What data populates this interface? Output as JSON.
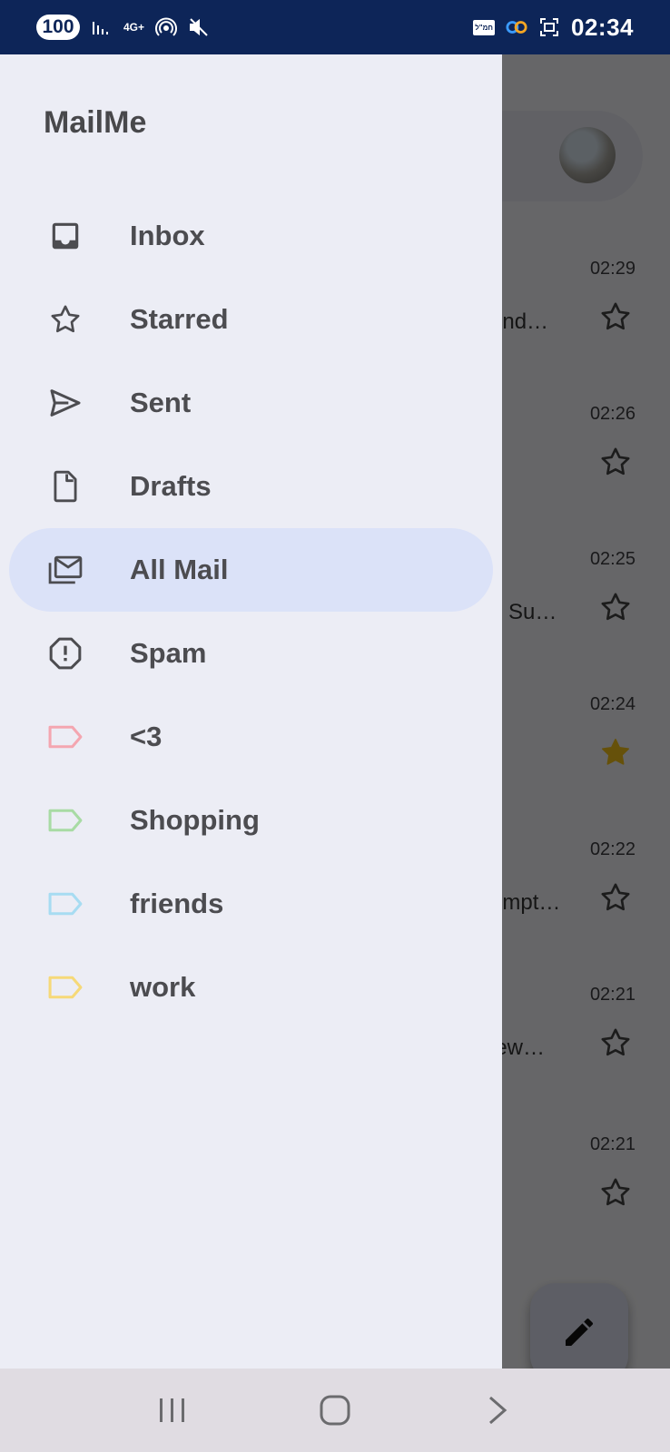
{
  "status_bar": {
    "battery": "100",
    "network": "4G+",
    "carrier_badge": "חמ\"ל",
    "time": "02:34"
  },
  "drawer": {
    "app_title": "MailMe",
    "items": [
      {
        "label": "Inbox",
        "icon": "inbox-icon"
      },
      {
        "label": "Starred",
        "icon": "star-outline-icon"
      },
      {
        "label": "Sent",
        "icon": "send-icon"
      },
      {
        "label": "Drafts",
        "icon": "draft-icon"
      },
      {
        "label": "All Mail",
        "icon": "all-mail-icon",
        "active": true
      },
      {
        "label": "Spam",
        "icon": "spam-icon"
      },
      {
        "label": "<3",
        "icon": "label-icon",
        "color": "#f4a6b0"
      },
      {
        "label": "Shopping",
        "icon": "label-icon",
        "color": "#a8dba4"
      },
      {
        "label": "friends",
        "icon": "label-icon",
        "color": "#a7dcf2"
      },
      {
        "label": "work",
        "icon": "label-icon",
        "color": "#f6d978"
      }
    ]
  },
  "email_list": {
    "rows": [
      {
        "time": "02:29",
        "snippet": "end…",
        "starred": false
      },
      {
        "time": "02:26",
        "snippet": "",
        "starred": false
      },
      {
        "time": "02:25",
        "snippet": "e Su…",
        "starred": false
      },
      {
        "time": "02:24",
        "snippet": "",
        "starred": true
      },
      {
        "time": "02:22",
        "snippet": "empt…",
        "starred": false
      },
      {
        "time": "02:21",
        "snippet": "iew…",
        "starred": false
      },
      {
        "time": "02:21",
        "snippet": "",
        "starred": false
      }
    ]
  },
  "colors": {
    "drawer_bg": "#ecedf5",
    "active_item_bg": "#dbe2f8",
    "status_bar_bg": "#0d2558",
    "star_filled": "#f2c21a"
  }
}
